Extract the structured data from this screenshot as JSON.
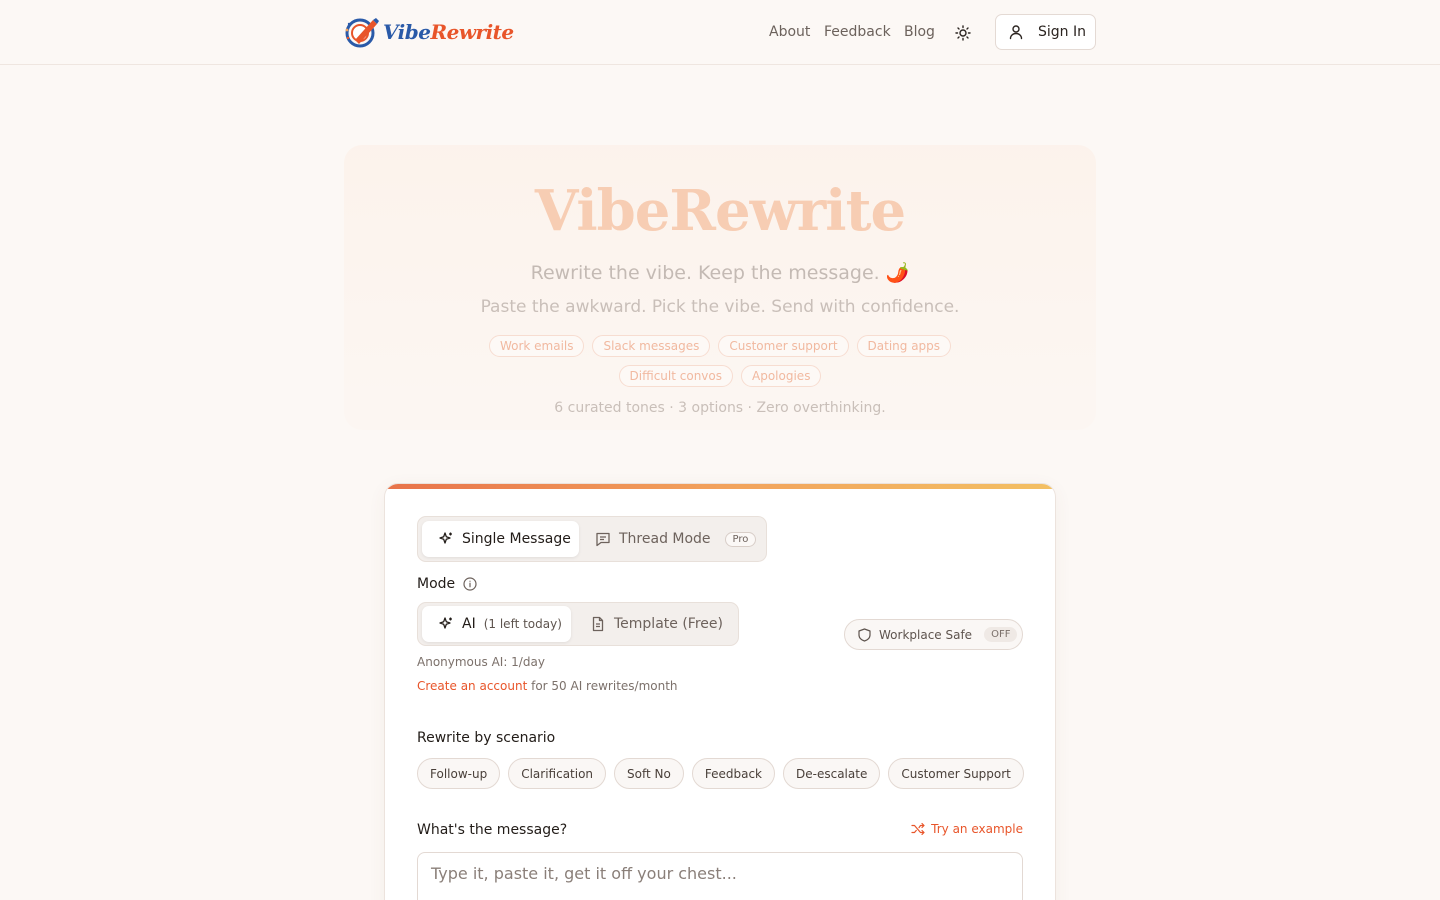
{
  "header": {
    "logo_vibe": "Vibe",
    "logo_rewrite": "Rewrite",
    "nav": [
      "About",
      "Feedback",
      "Blog"
    ],
    "signin_label": "Sign In"
  },
  "hero": {
    "title": "VibeRewrite",
    "subtitle": "Rewrite the vibe. Keep the message. 🌶️",
    "subtitle2": "Paste the awkward. Pick the vibe. Send with confidence.",
    "tags_row1": [
      "Work emails",
      "Slack messages",
      "Customer support",
      "Dating apps"
    ],
    "tags_row2": [
      "Difficult convos",
      "Apologies"
    ],
    "footer": "6 curated tones · 3 options · Zero overthinking."
  },
  "card": {
    "tabs": {
      "single": "Single Message",
      "thread": "Thread Mode",
      "pro_badge": "Pro"
    },
    "mode_label": "Mode",
    "mode": {
      "ai": "AI",
      "ai_quota": "(1 left today)",
      "template": "Template (Free)"
    },
    "workplace_safe": {
      "label": "Workplace Safe",
      "state": "OFF"
    },
    "anon_note": "Anonymous AI: 1/day",
    "create_account": "Create an account",
    "create_account_suffix": " for 50 AI rewrites/month",
    "scenario_label": "Rewrite by scenario",
    "scenarios": [
      "Follow-up",
      "Clarification",
      "Soft No",
      "Feedback",
      "De-escalate",
      "Customer Support"
    ],
    "message_label": "What's the message?",
    "try_example": "Try an example",
    "message_placeholder": "Type it, paste it, get it off your chest..."
  },
  "colors": {
    "accent": "#e8552a",
    "background": "#fcf8f5",
    "logo_blue": "#2a5aa8"
  },
  "icons": [
    "logo-pencil-icon",
    "sun-icon",
    "user-icon",
    "sparkle-icon",
    "message-icon",
    "info-icon",
    "document-icon",
    "shield-icon",
    "shuffle-icon"
  ]
}
